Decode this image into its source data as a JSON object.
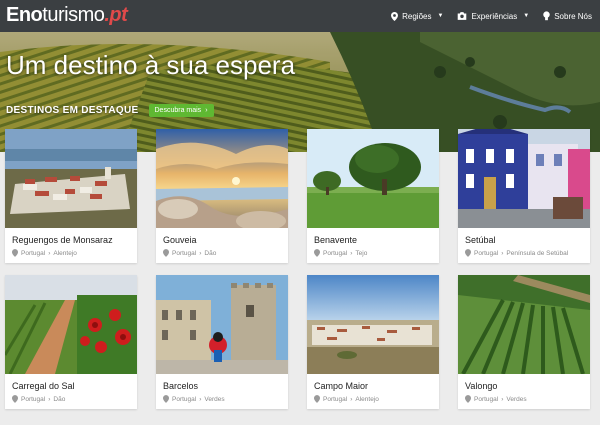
{
  "header": {
    "logo_main": "Eno",
    "logo_mid": "turismo",
    "logo_accent": ".pt",
    "nav": [
      {
        "icon": "map-pin-icon",
        "label": "Regiões",
        "dropdown": true
      },
      {
        "icon": "camera-icon",
        "label": "Experiências",
        "dropdown": true
      },
      {
        "icon": "lightbulb-icon",
        "label": "Sobre Nós",
        "dropdown": false
      }
    ]
  },
  "hero": {
    "title": "Um destino à sua espera",
    "featured_label": "DESTINOS EM DESTAQUE",
    "discover_label": "Descubra mais"
  },
  "cards": [
    {
      "name": "Reguengos de Monsaraz",
      "country": "Portugal",
      "region": "Alentejo",
      "scene": "village"
    },
    {
      "name": "Gouveia",
      "country": "Portugal",
      "region": "Dão",
      "scene": "sunset"
    },
    {
      "name": "Benavente",
      "country": "Portugal",
      "region": "Tejo",
      "scene": "tree"
    },
    {
      "name": "Setúbal",
      "country": "Portugal",
      "region": "Península de Setúbal",
      "scene": "house"
    },
    {
      "name": "Carregal do Sal",
      "country": "Portugal",
      "region": "Dão",
      "scene": "roses"
    },
    {
      "name": "Barcelos",
      "country": "Portugal",
      "region": "Verdes",
      "scene": "square"
    },
    {
      "name": "Campo Maior",
      "country": "Portugal",
      "region": "Alentejo",
      "scene": "town"
    },
    {
      "name": "Valongo",
      "country": "Portugal",
      "region": "Verdes",
      "scene": "vineyard"
    }
  ],
  "colors": {
    "header_bg": "#3b3f42",
    "accent_red": "#e04a4a",
    "button_green": "#5fb832"
  }
}
